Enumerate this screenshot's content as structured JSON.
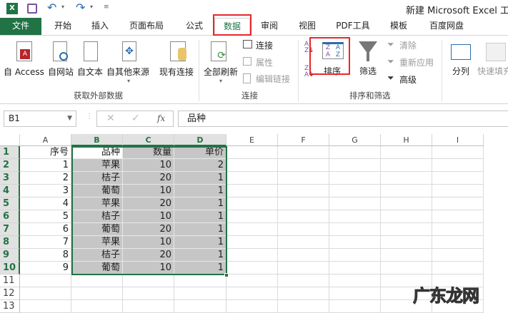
{
  "title": "新建 Microsoft Excel 工作",
  "tabs": [
    {
      "label": "文件"
    },
    {
      "label": "开始"
    },
    {
      "label": "插入"
    },
    {
      "label": "页面布局"
    },
    {
      "label": "公式"
    },
    {
      "label": "数据"
    },
    {
      "label": "审阅"
    },
    {
      "label": "视图"
    },
    {
      "label": "PDF工具"
    },
    {
      "label": "模板"
    },
    {
      "label": "百度网盘"
    }
  ],
  "ribbon": {
    "get_external": {
      "access": "自 Access",
      "web": "自网站",
      "text": "自文本",
      "other": "自其他来源",
      "existing": "现有连接",
      "group": "获取外部数据"
    },
    "connections": {
      "refresh_all": "全部刷新",
      "connections": "连接",
      "properties": "属性",
      "edit_links": "编辑链接",
      "group": "连接"
    },
    "sort_filter": {
      "sort": "排序",
      "filter": "筛选",
      "clear": "清除",
      "reapply": "重新应用",
      "advanced": "高级",
      "group": "排序和筛选"
    },
    "data_tools": {
      "text_to_columns": "分列",
      "flash_fill": "快速填充"
    }
  },
  "formula_bar": {
    "name_box": "B1",
    "fx": "fx",
    "value": "品种"
  },
  "columns": [
    "A",
    "B",
    "C",
    "D",
    "E",
    "F",
    "G",
    "H",
    "I"
  ],
  "rows": [
    [
      "序号",
      "品种",
      "数量",
      "单价"
    ],
    [
      "1",
      "苹果",
      "10",
      "2"
    ],
    [
      "2",
      "桔子",
      "20",
      "1"
    ],
    [
      "3",
      "葡萄",
      "10",
      "1"
    ],
    [
      "4",
      "苹果",
      "20",
      "1"
    ],
    [
      "5",
      "桔子",
      "10",
      "1"
    ],
    [
      "6",
      "葡萄",
      "20",
      "1"
    ],
    [
      "7",
      "苹果",
      "10",
      "1"
    ],
    [
      "8",
      "桔子",
      "20",
      "1"
    ],
    [
      "9",
      "葡萄",
      "10",
      "1"
    ]
  ],
  "row_numbers": [
    "1",
    "2",
    "3",
    "4",
    "5",
    "6",
    "7",
    "8",
    "9",
    "10",
    "11",
    "12",
    "13"
  ],
  "watermark": "广东龙网",
  "colors": {
    "excel_green": "#217346",
    "highlight": "#e8262b",
    "selection": "#c6c6c6"
  }
}
